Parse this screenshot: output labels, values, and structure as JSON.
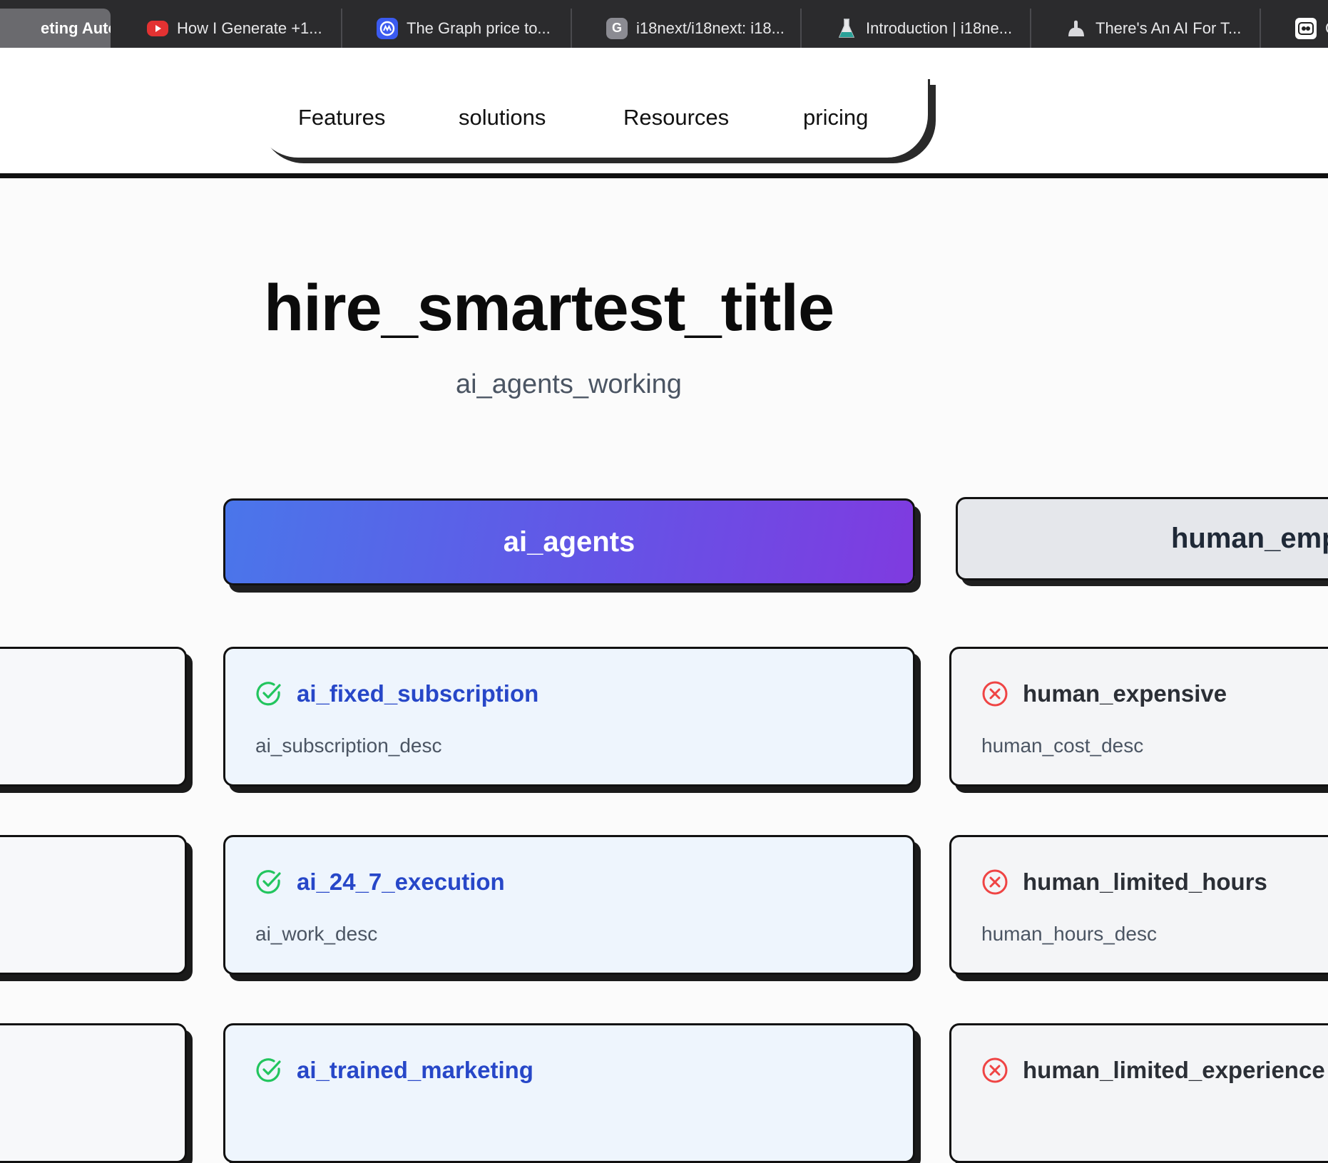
{
  "browser": {
    "tabs": [
      {
        "title": "eting Auto...",
        "icon": "generic-icon",
        "active": true
      },
      {
        "title": "How I Generate +1...",
        "icon": "youtube-icon"
      },
      {
        "title": "The Graph price to...",
        "icon": "coinmarketcap-icon"
      },
      {
        "title": "i18next/i18next: i18...",
        "icon": "github-icon"
      },
      {
        "title": "Introduction | i18ne...",
        "icon": "flask-icon"
      },
      {
        "title": "There's An AI For T...",
        "icon": "arm-icon"
      },
      {
        "title": "C",
        "icon": "app-icon"
      }
    ]
  },
  "nav": {
    "items": [
      "Features",
      "solutions",
      "Resources",
      "pricing"
    ]
  },
  "hero": {
    "title": "hire_smartest_title",
    "subtitle": "ai_agents_working"
  },
  "columns": {
    "ai_label": "ai_agents",
    "human_label": "human_emp"
  },
  "cards": {
    "ai": [
      {
        "title": "ai_fixed_subscription",
        "desc": "ai_subscription_desc"
      },
      {
        "title": "ai_24_7_execution",
        "desc": "ai_work_desc"
      },
      {
        "title": "ai_trained_marketing",
        "desc": ""
      }
    ],
    "human": [
      {
        "title": "human_expensive",
        "desc": "human_cost_desc"
      },
      {
        "title": "human_limited_hours",
        "desc": "human_hours_desc"
      },
      {
        "title": "human_limited_experience",
        "desc": ""
      }
    ]
  },
  "colors": {
    "check": "#22c55e",
    "cross": "#ef4444",
    "ai_title": "#2747c8",
    "gradient_start": "#4a76ea",
    "gradient_end": "#7f3be0"
  }
}
